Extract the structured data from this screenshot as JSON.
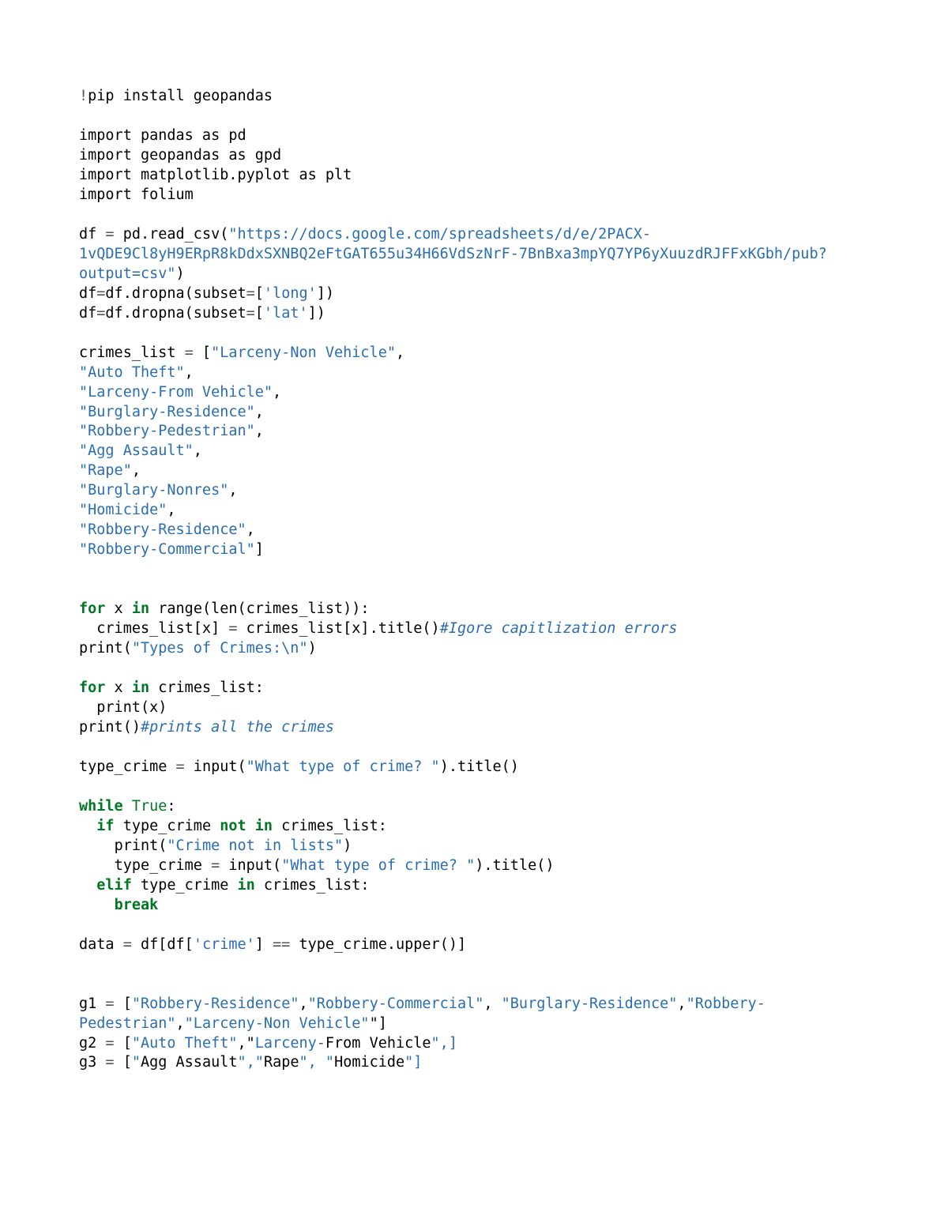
{
  "code_lines": [
    [
      {
        "cls": "op",
        "t": "!"
      },
      {
        "cls": "nm",
        "t": "pip install geopandas"
      }
    ],
    [],
    [
      {
        "cls": "nm",
        "t": "import pandas as pd"
      }
    ],
    [
      {
        "cls": "nm",
        "t": "import geopandas as gpd"
      }
    ],
    [
      {
        "cls": "nm",
        "t": "import matplotlib.pyplot as plt "
      }
    ],
    [
      {
        "cls": "nm",
        "t": "import folium"
      }
    ],
    [],
    [
      {
        "cls": "nm",
        "t": "df "
      },
      {
        "cls": "op",
        "t": "="
      },
      {
        "cls": "nm",
        "t": " pd.read_csv("
      },
      {
        "cls": "str",
        "t": "\"https://docs.google.com/spreadsheets/d/e/2PACX-1vQDE9Cl8yH9ERpR8kDdxSXNBQ2eFtGAT655u34H66VdSzNrF-7BnBxa3mpYQ7YP6yXuuzdRJFFxKGbh/pub?output=csv\""
      },
      {
        "cls": "nm",
        "t": ")"
      }
    ],
    [
      {
        "cls": "nm",
        "t": "df"
      },
      {
        "cls": "op",
        "t": "="
      },
      {
        "cls": "nm",
        "t": "df.dropna(subset"
      },
      {
        "cls": "op",
        "t": "="
      },
      {
        "cls": "nm",
        "t": "["
      },
      {
        "cls": "str",
        "t": "'long'"
      },
      {
        "cls": "nm",
        "t": "])"
      }
    ],
    [
      {
        "cls": "nm",
        "t": "df"
      },
      {
        "cls": "op",
        "t": "="
      },
      {
        "cls": "nm",
        "t": "df.dropna(subset"
      },
      {
        "cls": "op",
        "t": "="
      },
      {
        "cls": "nm",
        "t": "["
      },
      {
        "cls": "str",
        "t": "'lat'"
      },
      {
        "cls": "nm",
        "t": "])"
      }
    ],
    [],
    [
      {
        "cls": "nm",
        "t": "crimes_list "
      },
      {
        "cls": "op",
        "t": "="
      },
      {
        "cls": "nm",
        "t": " ["
      },
      {
        "cls": "str",
        "t": "\"Larceny-Non Vehicle\""
      },
      {
        "cls": "nm",
        "t": ","
      }
    ],
    [
      {
        "cls": "str",
        "t": "\"Auto Theft\""
      },
      {
        "cls": "nm",
        "t": ","
      }
    ],
    [
      {
        "cls": "str",
        "t": "\"Larceny-From Vehicle\""
      },
      {
        "cls": "nm",
        "t": ","
      }
    ],
    [
      {
        "cls": "str",
        "t": "\"Burglary-Residence\""
      },
      {
        "cls": "nm",
        "t": ","
      }
    ],
    [
      {
        "cls": "str",
        "t": "\"Robbery-Pedestrian\""
      },
      {
        "cls": "nm",
        "t": ","
      }
    ],
    [
      {
        "cls": "str",
        "t": "\"Agg Assault\""
      },
      {
        "cls": "nm",
        "t": ","
      }
    ],
    [
      {
        "cls": "str",
        "t": "\"Rape\""
      },
      {
        "cls": "nm",
        "t": ","
      }
    ],
    [
      {
        "cls": "str",
        "t": "\"Burglary-Nonres\""
      },
      {
        "cls": "nm",
        "t": ","
      }
    ],
    [
      {
        "cls": "str",
        "t": "\"Homicide\""
      },
      {
        "cls": "nm",
        "t": ","
      }
    ],
    [
      {
        "cls": "str",
        "t": "\"Robbery-Residence\""
      },
      {
        "cls": "nm",
        "t": ","
      }
    ],
    [
      {
        "cls": "str",
        "t": "\"Robbery-Commercial\""
      },
      {
        "cls": "nm",
        "t": "]"
      }
    ],
    [],
    [],
    [
      {
        "cls": "kw",
        "t": "for"
      },
      {
        "cls": "nm",
        "t": " x "
      },
      {
        "cls": "kw",
        "t": "in"
      },
      {
        "cls": "nm",
        "t": " range(len(crimes_list)):"
      }
    ],
    [
      {
        "cls": "nm",
        "t": "  crimes_list[x] "
      },
      {
        "cls": "op",
        "t": "="
      },
      {
        "cls": "nm",
        "t": " crimes_list[x].title()"
      },
      {
        "cls": "cm",
        "t": "#Igore capitlization errors"
      }
    ],
    [
      {
        "cls": "nm",
        "t": "print("
      },
      {
        "cls": "str",
        "t": "\"Types of Crimes:\\n\""
      },
      {
        "cls": "nm",
        "t": ")"
      }
    ],
    [],
    [
      {
        "cls": "kw",
        "t": "for"
      },
      {
        "cls": "nm",
        "t": " x "
      },
      {
        "cls": "kw",
        "t": "in"
      },
      {
        "cls": "nm",
        "t": " crimes_list:"
      }
    ],
    [
      {
        "cls": "nm",
        "t": "  print(x)"
      }
    ],
    [
      {
        "cls": "nm",
        "t": "print()"
      },
      {
        "cls": "cm",
        "t": "#prints all the crimes"
      }
    ],
    [],
    [
      {
        "cls": "nm",
        "t": "type_crime "
      },
      {
        "cls": "op",
        "t": "="
      },
      {
        "cls": "nm",
        "t": " input("
      },
      {
        "cls": "str",
        "t": "\"What type of crime? \""
      },
      {
        "cls": "nm",
        "t": ").title()"
      }
    ],
    [],
    [
      {
        "cls": "kw",
        "t": "while"
      },
      {
        "cls": "nm",
        "t": " "
      },
      {
        "cls": "bi",
        "t": "True"
      },
      {
        "cls": "nm",
        "t": ":"
      }
    ],
    [
      {
        "cls": "nm",
        "t": "  "
      },
      {
        "cls": "kw",
        "t": "if"
      },
      {
        "cls": "nm",
        "t": " type_crime "
      },
      {
        "cls": "kw",
        "t": "not in"
      },
      {
        "cls": "nm",
        "t": " crimes_list:"
      }
    ],
    [
      {
        "cls": "nm",
        "t": "    print("
      },
      {
        "cls": "str",
        "t": "\"Crime not in lists\""
      },
      {
        "cls": "nm",
        "t": ")"
      }
    ],
    [
      {
        "cls": "nm",
        "t": "    type_crime "
      },
      {
        "cls": "op",
        "t": "="
      },
      {
        "cls": "nm",
        "t": " input("
      },
      {
        "cls": "str",
        "t": "\"What type of crime? \""
      },
      {
        "cls": "nm",
        "t": ").title()"
      }
    ],
    [
      {
        "cls": "nm",
        "t": "  "
      },
      {
        "cls": "kw",
        "t": "elif"
      },
      {
        "cls": "nm",
        "t": " type_crime "
      },
      {
        "cls": "kw",
        "t": "in"
      },
      {
        "cls": "nm",
        "t": " crimes_list:"
      }
    ],
    [
      {
        "cls": "nm",
        "t": "    "
      },
      {
        "cls": "kw",
        "t": "break"
      }
    ],
    [],
    [
      {
        "cls": "nm",
        "t": "data "
      },
      {
        "cls": "op",
        "t": "="
      },
      {
        "cls": "nm",
        "t": " df[df["
      },
      {
        "cls": "str",
        "t": "'crime'"
      },
      {
        "cls": "nm",
        "t": "] "
      },
      {
        "cls": "op",
        "t": "=="
      },
      {
        "cls": "nm",
        "t": " type_crime.upper()]"
      }
    ],
    [],
    [],
    [
      {
        "cls": "nm",
        "t": "g1 "
      },
      {
        "cls": "op",
        "t": "="
      },
      {
        "cls": "nm",
        "t": " ["
      },
      {
        "cls": "str",
        "t": "\"Robbery-Residence\""
      },
      {
        "cls": "nm",
        "t": ","
      },
      {
        "cls": "str",
        "t": "\"Robbery-Commercial\""
      },
      {
        "cls": "nm",
        "t": ", "
      },
      {
        "cls": "str",
        "t": "\"Burglary-Residence\""
      },
      {
        "cls": "nm",
        "t": ","
      },
      {
        "cls": "str",
        "t": "\"Robbery-Pedestrian\""
      },
      {
        "cls": "nm",
        "t": ","
      },
      {
        "cls": "str",
        "t": "\"Larceny-Non Vehicle\""
      },
      {
        "cls": "err",
        "t": "\""
      },
      {
        "cls": "nm",
        "t": "]"
      }
    ],
    [
      {
        "cls": "nm",
        "t": "g2 "
      },
      {
        "cls": "op",
        "t": "="
      },
      {
        "cls": "nm",
        "t": " ["
      },
      {
        "cls": "str",
        "t": "\"Auto Theft\""
      },
      {
        "cls": "nm",
        "t": ",\""
      },
      {
        "cls": "str",
        "t": "Larceny"
      },
      {
        "cls": "op",
        "t": "-"
      },
      {
        "cls": "nm",
        "t": "From Vehicle"
      },
      {
        "cls": "str",
        "t": "\",]"
      }
    ],
    [
      {
        "cls": "nm",
        "t": "g3 "
      },
      {
        "cls": "op",
        "t": "="
      },
      {
        "cls": "nm",
        "t": " ["
      },
      {
        "cls": "str",
        "t": "\""
      },
      {
        "cls": "nm",
        "t": "Agg Assault"
      },
      {
        "cls": "str",
        "t": "\",\""
      },
      {
        "cls": "nm",
        "t": "Rape"
      },
      {
        "cls": "str",
        "t": "\", \""
      },
      {
        "cls": "nm",
        "t": "Homicide"
      },
      {
        "cls": "str",
        "t": "\"]"
      }
    ]
  ]
}
